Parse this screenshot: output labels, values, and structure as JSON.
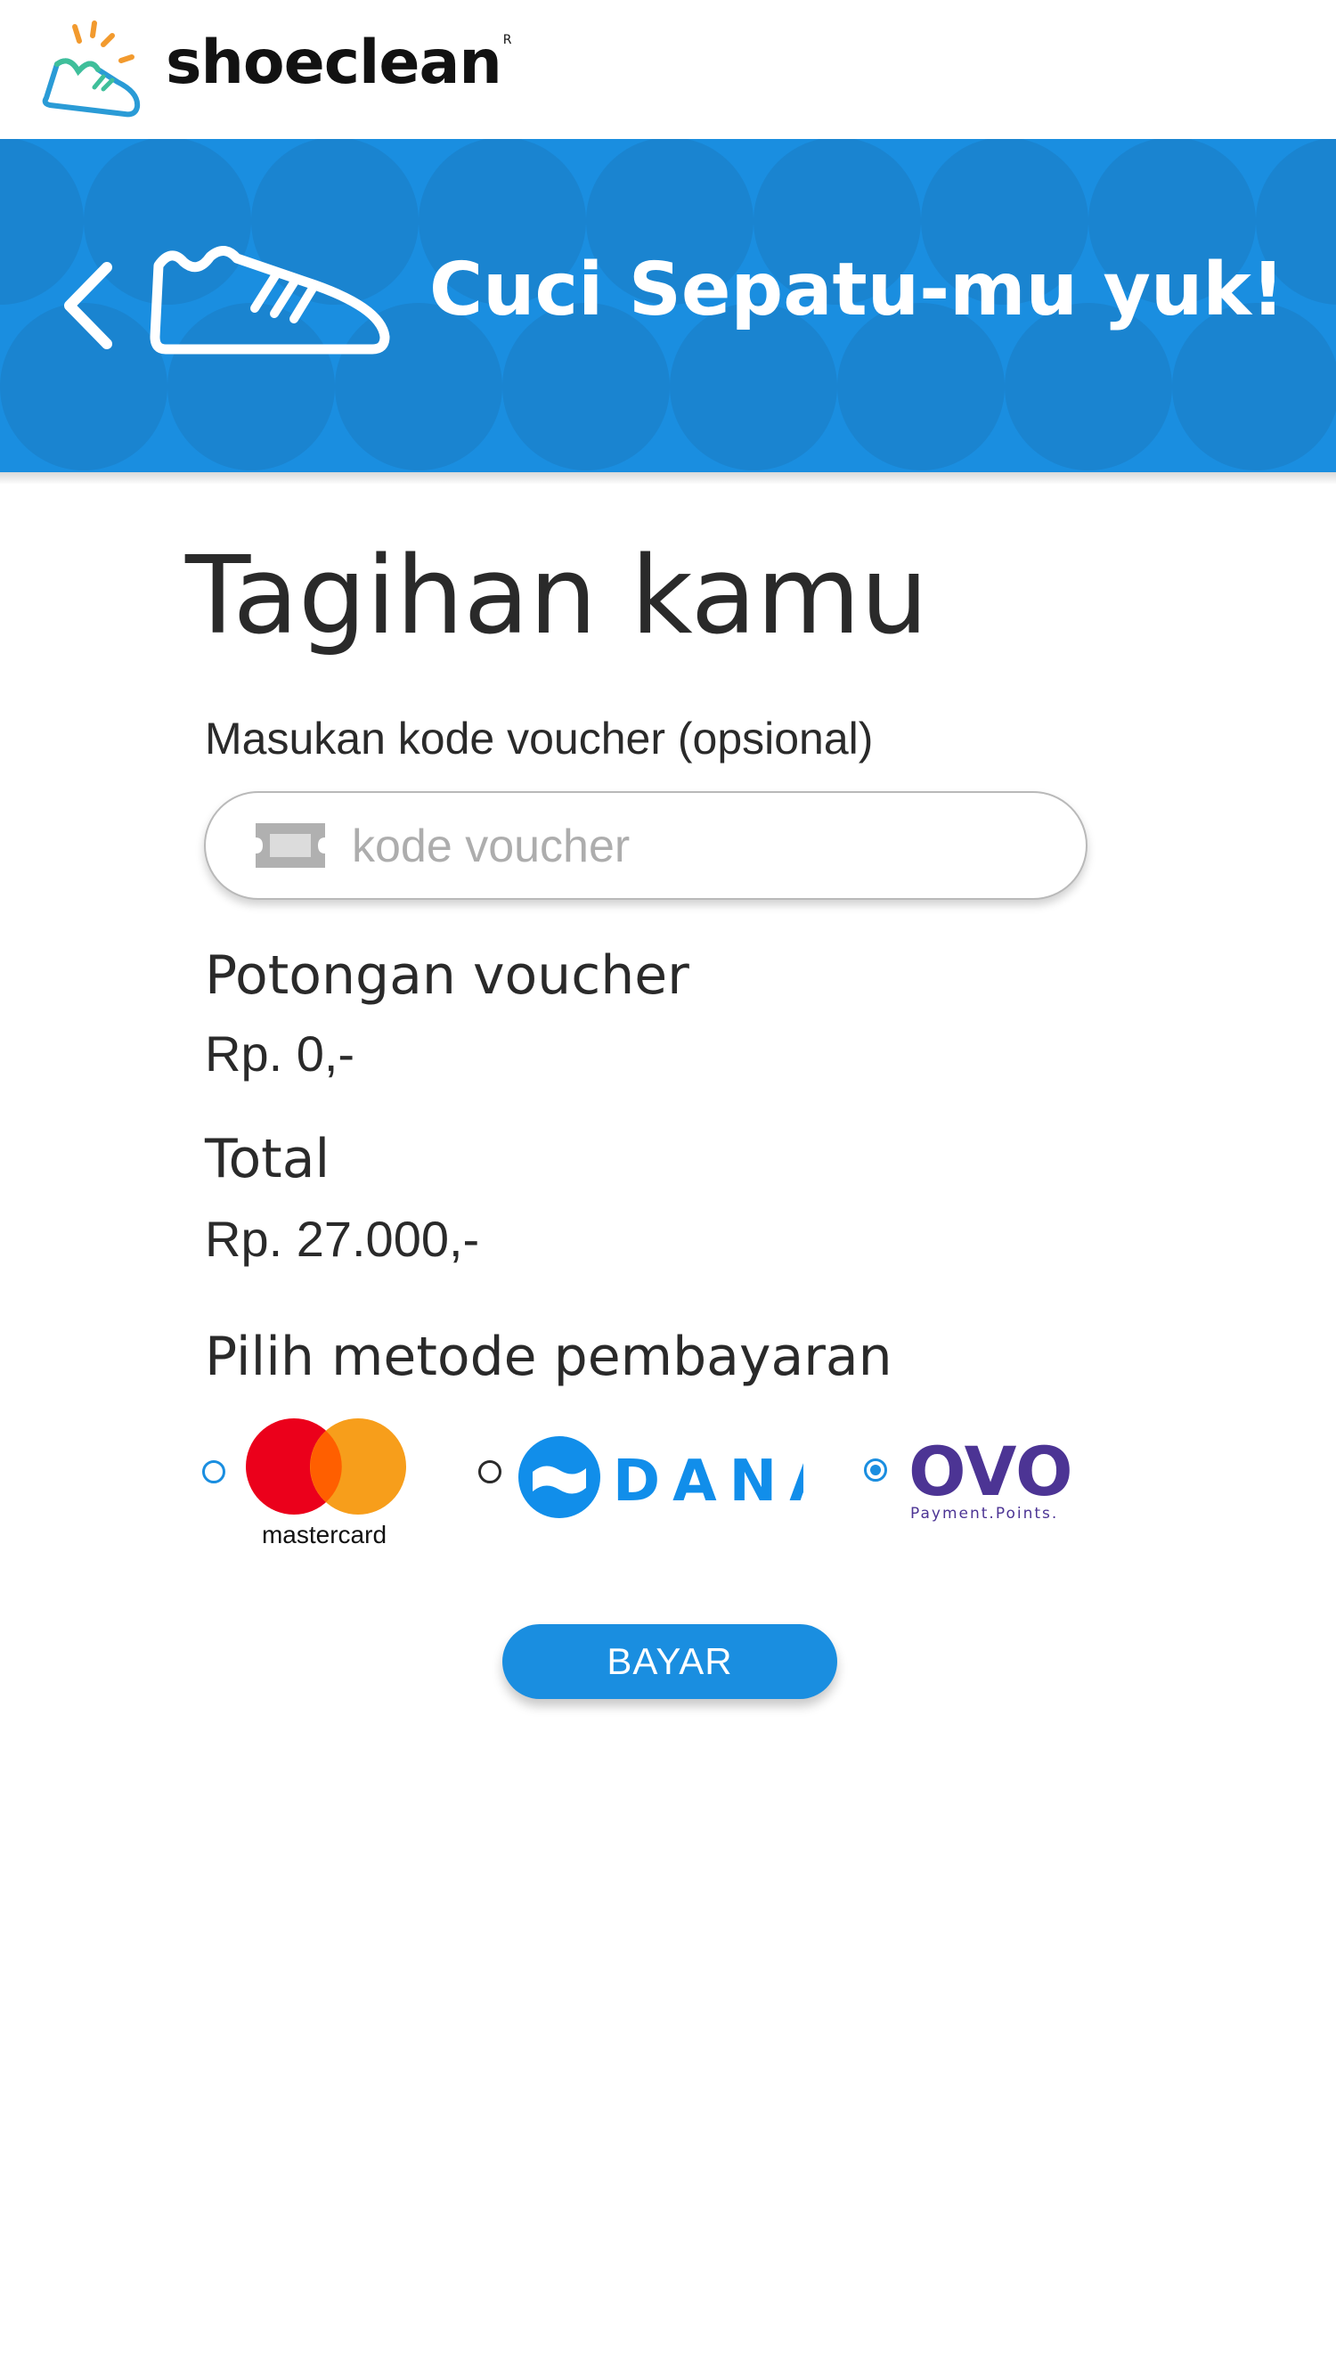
{
  "brand": {
    "name": "shoeclean",
    "trademark": "R"
  },
  "header": {
    "title": "Cuci Sepatu-mu yuk!"
  },
  "page": {
    "title": "Tagihan kamu"
  },
  "voucher": {
    "label": "Masukan kode voucher (opsional)",
    "placeholder": "kode voucher",
    "value": ""
  },
  "discount": {
    "label": "Potongan voucher",
    "value": "Rp. 0,-"
  },
  "total": {
    "label": "Total",
    "value": "Rp. 27.000,-"
  },
  "payment": {
    "label": "Pilih metode pembayaran",
    "options": [
      {
        "id": "mastercard",
        "logo_text": "mastercard",
        "selected": false
      },
      {
        "id": "dana",
        "logo_text": "DANA",
        "selected": false
      },
      {
        "id": "ovo",
        "logo_text": "OVO",
        "sub_text": "Payment.Points.",
        "selected": true
      }
    ]
  },
  "action": {
    "pay_label": "BAYAR"
  },
  "colors": {
    "primary": "#1a8ee0",
    "band_circle": "#1a84d0",
    "text": "#2a2a2a",
    "ovo": "#4c3494"
  }
}
